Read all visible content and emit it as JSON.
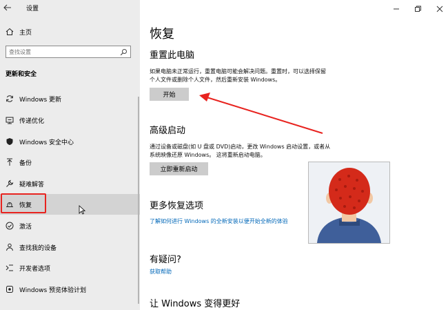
{
  "window": {
    "title": "设置"
  },
  "sidebar": {
    "home_label": "主页",
    "search_placeholder": "查找设置",
    "section_title": "更新和安全",
    "items": [
      {
        "label": "Windows 更新",
        "icon": "sync-icon"
      },
      {
        "label": "传递优化",
        "icon": "delivery-optimization-icon"
      },
      {
        "label": "Windows 安全中心",
        "icon": "shield-icon"
      },
      {
        "label": "备份",
        "icon": "backup-arrow-icon"
      },
      {
        "label": "疑难解答",
        "icon": "wrench-icon"
      },
      {
        "label": "恢复",
        "icon": "recovery-icon"
      },
      {
        "label": "激活",
        "icon": "check-circle-icon"
      },
      {
        "label": "查找我的设备",
        "icon": "person-locate-icon"
      },
      {
        "label": "开发者选项",
        "icon": "developer-icon"
      },
      {
        "label": "Windows 预览体验计划",
        "icon": "insider-icon"
      }
    ]
  },
  "main": {
    "page_title": "恢复",
    "reset": {
      "title": "重置此电脑",
      "desc_line1": "如果电脑未正常运行，重置电脑可能会解决问题。重置时，可以选择保留",
      "desc_line2": "个人文件或删除个人文件，然后重新安装 Windows。",
      "button": "开始"
    },
    "advanced": {
      "title": "高级启动",
      "desc_line1": "通过设备或磁盘(如 U 盘或 DVD)启动，更改 Windows 启动设置，或者从",
      "desc_line2": "系统映像还原 Windows。 这将重新启动电脑。",
      "button": "立即重新启动"
    },
    "more": {
      "title": "更多恢复选项",
      "link": "了解如何进行 Windows 的全新安装以便开始全新的体验"
    },
    "help": {
      "title": "有疑问?",
      "link": "获取帮助"
    },
    "improve": {
      "title": "让 Windows 变得更好"
    }
  },
  "colors": {
    "sidebar_bg": "#ececec",
    "accent_link": "#0067b8",
    "button_bg": "#cccccc",
    "annotation_red": "#e8231f",
    "avatar_hair": "#d42a1a",
    "avatar_shirt": "#3f5f9a",
    "avatar_skin": "#f2c8a4"
  }
}
